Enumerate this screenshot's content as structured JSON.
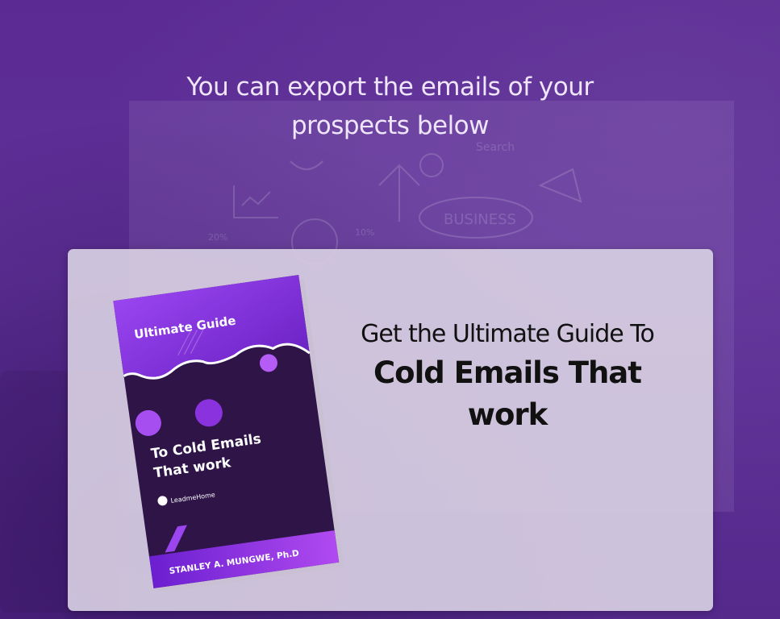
{
  "hero": {
    "line1": "You can export the emails of your",
    "line2": "prospects below"
  },
  "offer": {
    "subtitle": "Get the Ultimate Guide To",
    "title": "Cold Emails That work"
  },
  "book": {
    "banner": "Ultimate Guide",
    "title_line1": "To Cold Emails",
    "title_line2": "That work",
    "brand": "LeadmeHome",
    "author": "STANLEY A. MUNGWE, Ph.D"
  },
  "background_sketch": {
    "search_label": "Search",
    "business_label": "BUSINESS",
    "percent_left": "20%",
    "percent_mid": "10%"
  },
  "colors": {
    "purple_bg": "#5a2d91",
    "card_bg": "#d6cde1",
    "book_top": "#8a3be0",
    "book_dark": "#2a1240"
  }
}
